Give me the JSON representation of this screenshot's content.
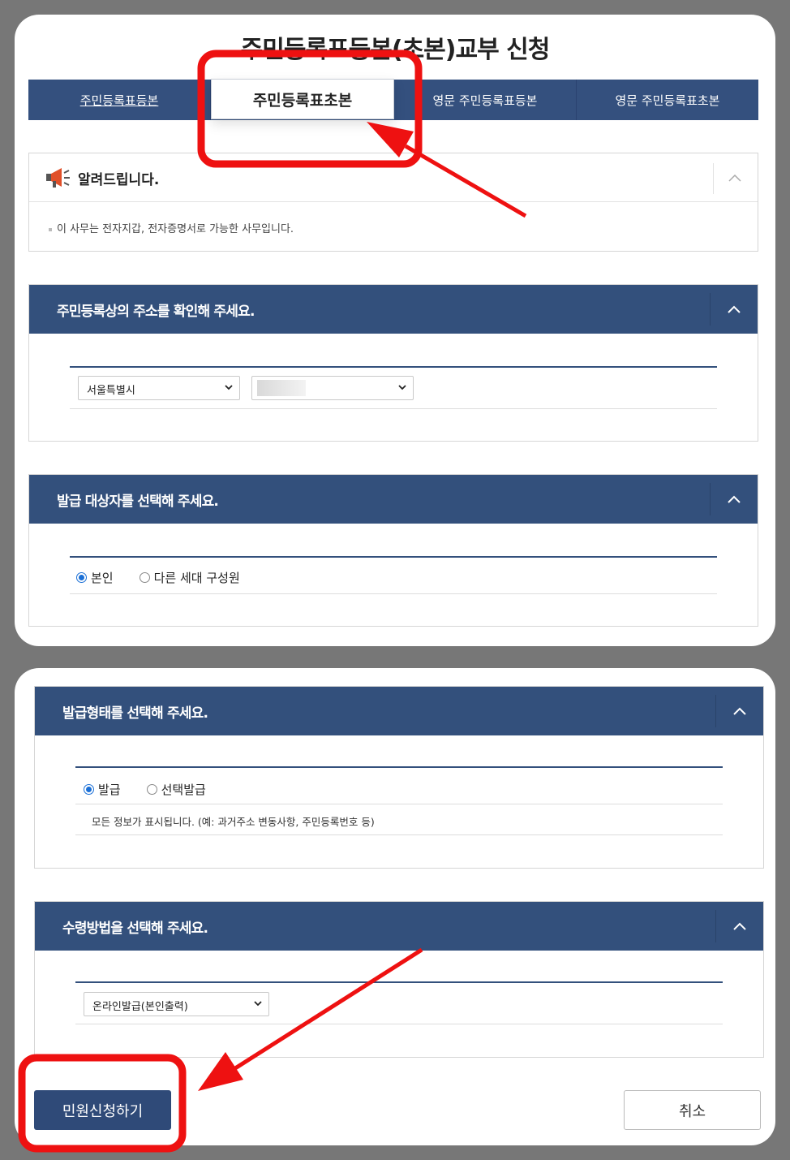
{
  "page_title": "주민등록표등본(초본)교부 신청",
  "tabs": [
    {
      "label": "주민등록표등본"
    },
    {
      "label": "주민등록표초본"
    },
    {
      "label": "영문 주민등록표등본"
    },
    {
      "label": "영문 주민등록표초본"
    }
  ],
  "notice": {
    "title": "알려드립니다.",
    "body": "이 사무는 전자지갑, 전자증명서로 가능한 사무입니다."
  },
  "address_section": {
    "title": "주민등록상의 주소를 확인해 주세요.",
    "city_select": "서울특별시",
    "district_select": ""
  },
  "target_section": {
    "title": "발급 대상자를 선택해 주세요.",
    "options": [
      "본인",
      "다른 세대 구성원"
    ]
  },
  "format_section": {
    "title": "발급형태를 선택해 주세요.",
    "options": [
      "발급",
      "선택발급"
    ],
    "description": "모든 정보가 표시됩니다. (예: 과거주소 변동사항, 주민등록번호 등)"
  },
  "receive_section": {
    "title": "수령방법을 선택해 주세요.",
    "method_select": "온라인발급(본인출력)"
  },
  "buttons": {
    "submit": "민원신청하기",
    "cancel": "취소"
  },
  "colors": {
    "navy": "#33507c",
    "annotation_red": "#ee1111",
    "radio_blue": "#1a6fd6"
  }
}
